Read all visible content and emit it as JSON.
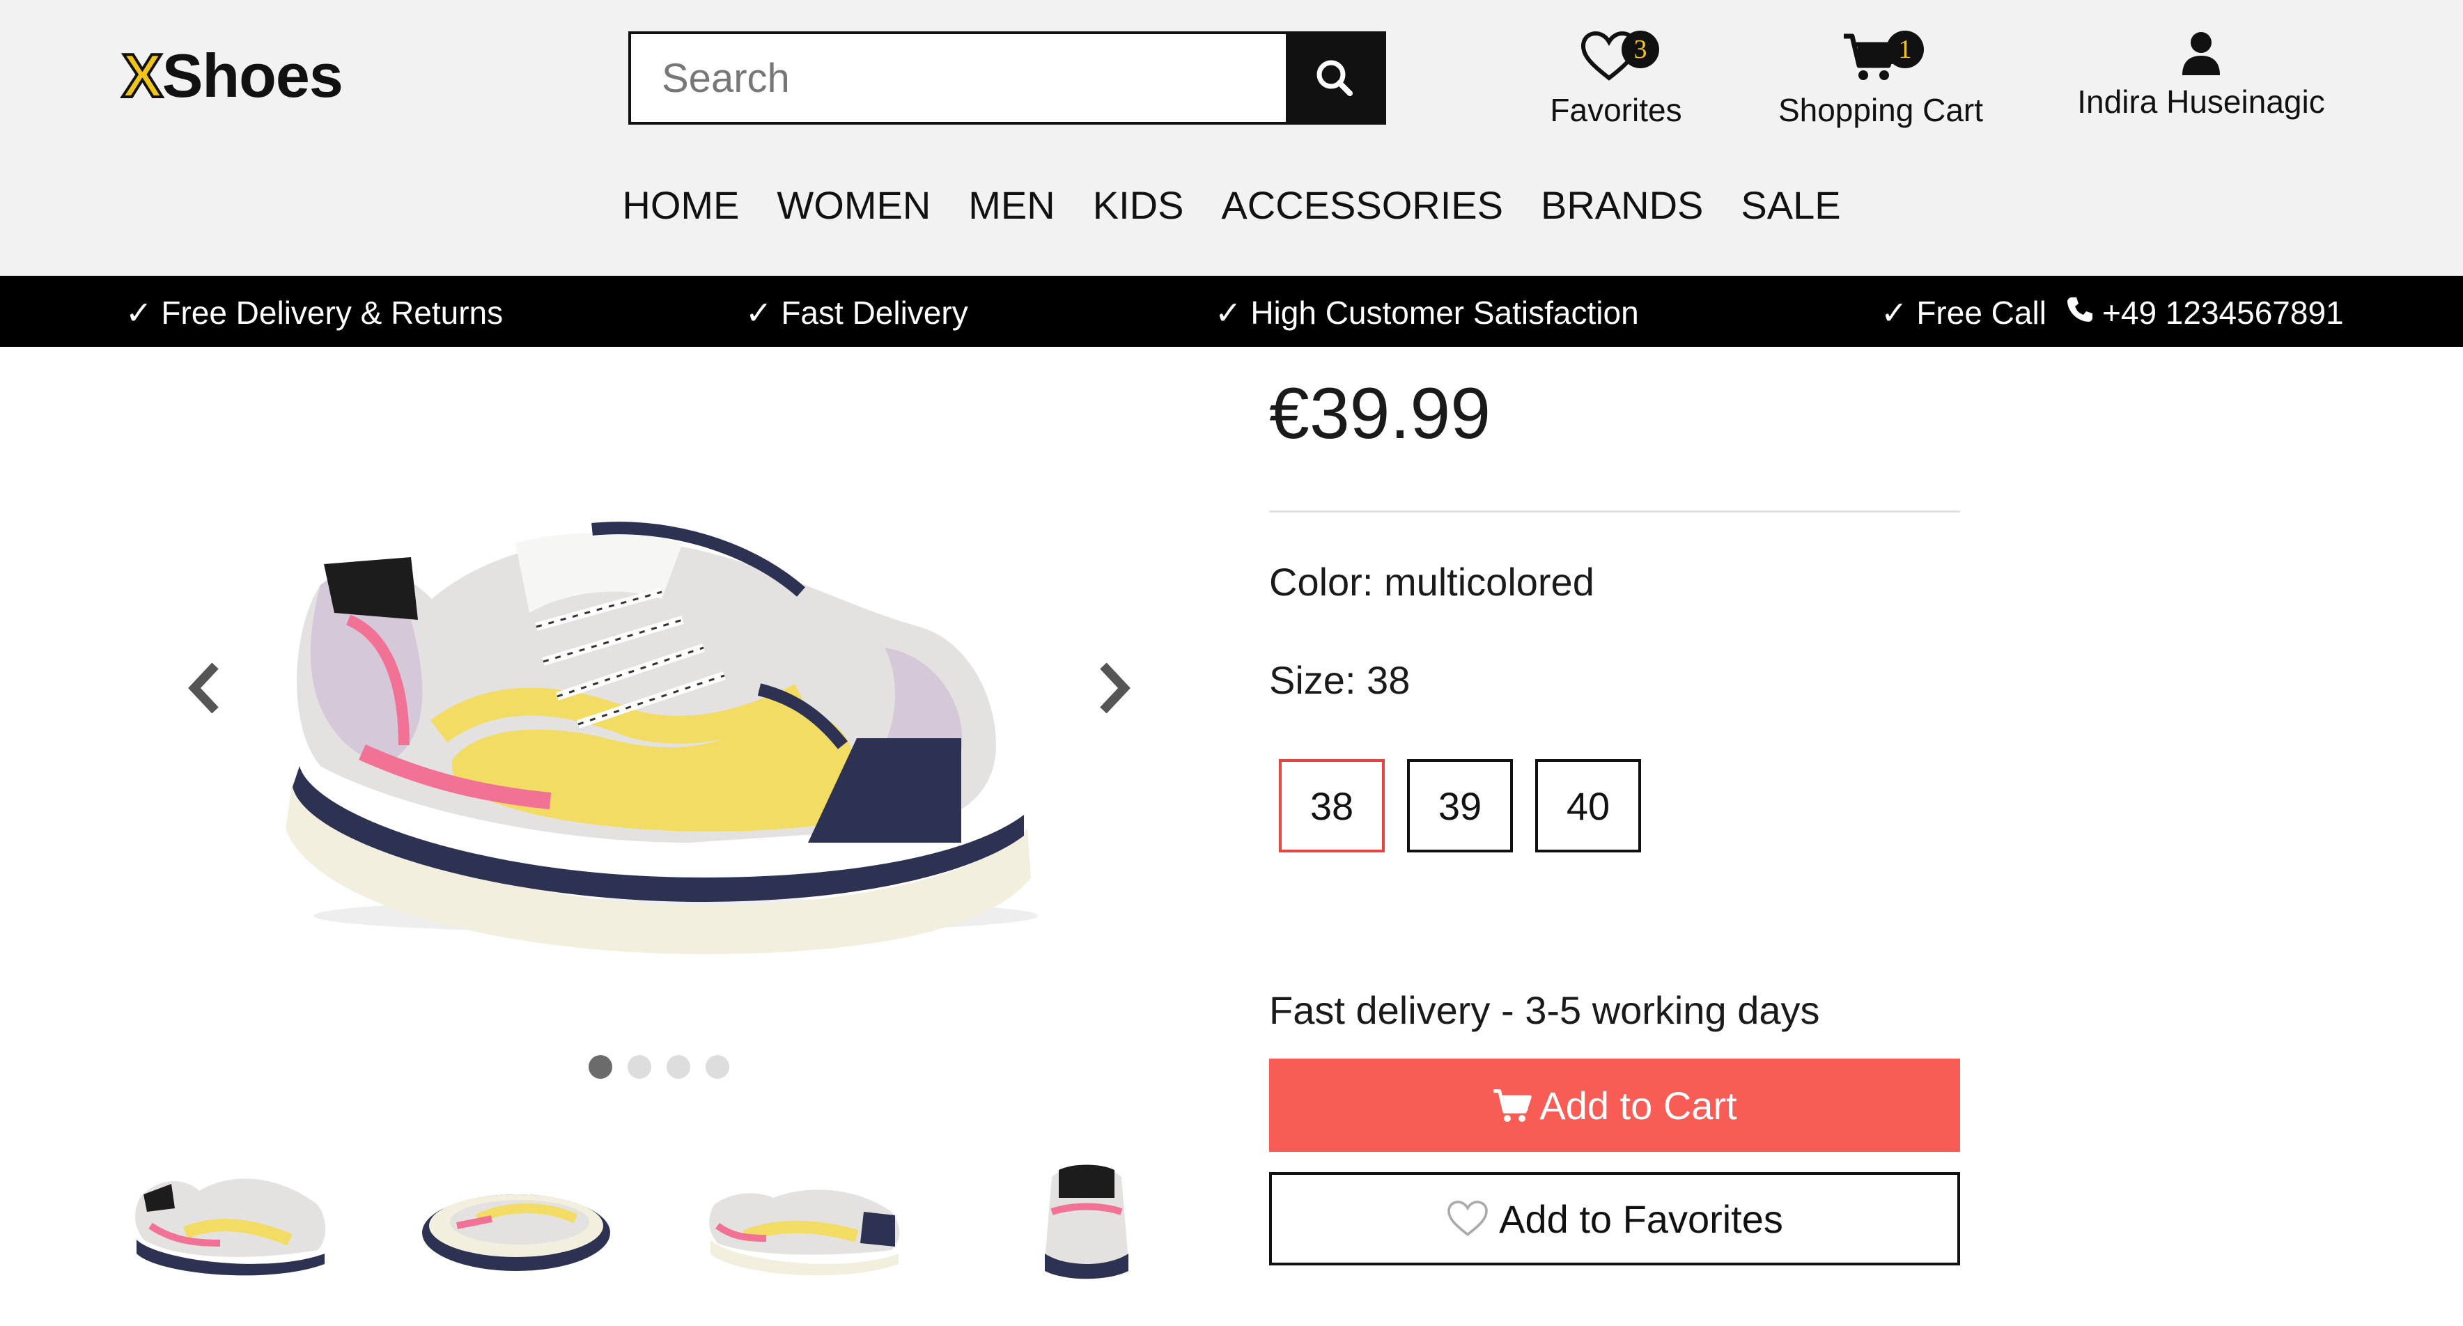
{
  "header": {
    "logo_x": "X",
    "logo_text": "Shoes",
    "search_placeholder": "Search",
    "favorites_label": "Favorites",
    "favorites_count": "3",
    "cart_label": "Shopping Cart",
    "cart_count": "1",
    "user_name": "Indira Huseinagic"
  },
  "nav": [
    "HOME",
    "WOMEN",
    "MEN",
    "KIDS",
    "ACCESSORIES",
    "BRANDS",
    "SALE"
  ],
  "promo": {
    "item1": "✓ Free Delivery & Returns",
    "item2": "✓ Fast Delivery",
    "item3": "✓ High Customer Satisfaction",
    "item4": "✓ Free Call",
    "phone": "+49 1234567891"
  },
  "gallery": {
    "slide_count": 4,
    "active_slide": 1
  },
  "product": {
    "price": "€39.99",
    "color_text": "Color: multicolored",
    "size_text": "Size: 38",
    "sizes": [
      "38",
      "39",
      "40"
    ],
    "selected_size": "38",
    "delivery_text": "Fast delivery - 3-5 working days",
    "add_to_cart": "Add to Cart",
    "add_to_favorites": "Add to Favorites"
  },
  "colors": {
    "accent_cart": "#f85d55",
    "selected_size_border": "#e4473f",
    "logo_yellow": "#f0c419",
    "promo_bar": "#000000",
    "header_bg": "#f2f2f2"
  }
}
